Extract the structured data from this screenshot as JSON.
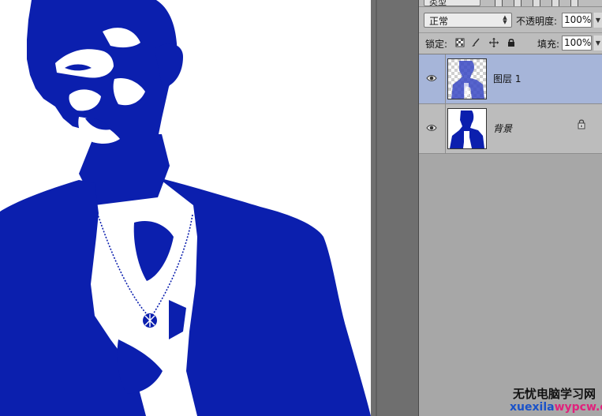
{
  "canvas": {
    "ink_color": "#0b1fae",
    "background_color": "#ffffff"
  },
  "layers_panel": {
    "kind_filter": {
      "label": "类型"
    },
    "blend_mode": {
      "value": "正常"
    },
    "opacity": {
      "label": "不透明度:",
      "value": "100%"
    },
    "lock": {
      "label": "锁定:",
      "icons": [
        "lock-transparent-pixels-icon",
        "lock-image-pixels-icon",
        "lock-position-icon",
        "lock-all-icon"
      ]
    },
    "fill": {
      "label": "填充:",
      "value": "100%"
    },
    "layers": [
      {
        "name": "图层 1",
        "selected": true,
        "visible": true,
        "locked": false
      },
      {
        "name": "背景",
        "selected": false,
        "visible": true,
        "locked": true
      }
    ],
    "selected_color": "#a6b5d9"
  },
  "watermark": {
    "line1": "无忧电脑学习网",
    "line2_a": "xuexila",
    "line2_b": "wypcw.com"
  }
}
